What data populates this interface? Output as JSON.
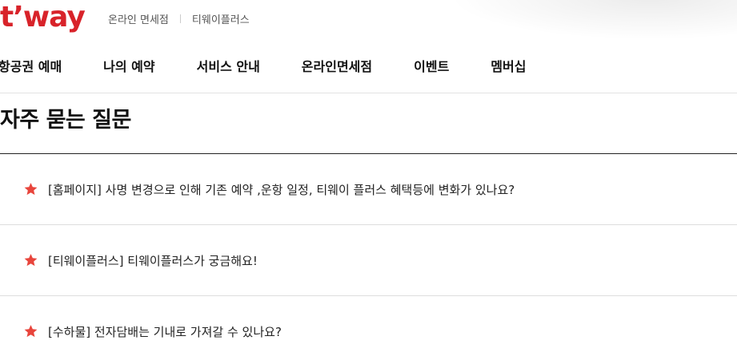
{
  "header": {
    "logo_text": "t’way",
    "util_links": [
      "온라인 면세점",
      "티웨이플러스"
    ]
  },
  "gnb": {
    "items": [
      "항공권 예매",
      "나의 예약",
      "서비스 안내",
      "온라인면세점",
      "이벤트",
      "멤버십"
    ]
  },
  "page": {
    "title": "자주 묻는 질문"
  },
  "faq": {
    "items": [
      {
        "question": "[홈페이지] 사명 변경으로 인해 기존 예약 ,운항 일정, 티웨이 플러스 혜택등에 변화가 있나요?"
      },
      {
        "question": "[티웨이플러스] 티웨이플러스가 궁금해요!"
      },
      {
        "question": "[수하물] 전자담배는 기내로 가져갈 수 있나요?"
      }
    ]
  },
  "colors": {
    "brand_red": "#d8232a",
    "star_red": "#e8453c"
  },
  "icons": {
    "faq_marker": "star-icon"
  }
}
